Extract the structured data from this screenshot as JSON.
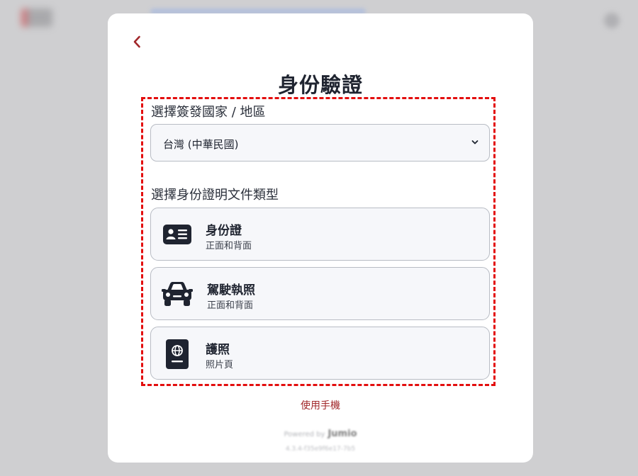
{
  "modal": {
    "title": "身份驗證",
    "country": {
      "label": "選擇簽發國家 / 地區",
      "selected": "台灣 (中華民國)"
    },
    "document_type": {
      "label": "選擇身份證明文件類型",
      "options": [
        {
          "title": "身份證",
          "subtitle": "正面和背面",
          "icon": "id-card-icon"
        },
        {
          "title": "駕駛執照",
          "subtitle": "正面和背面",
          "icon": "car-icon"
        },
        {
          "title": "護照",
          "subtitle": "照片頁",
          "icon": "passport-icon"
        }
      ]
    },
    "use_phone_link": "使用手機",
    "powered_by": {
      "text": "Powered by",
      "brand": "Jumio"
    },
    "version": "4.3.4-f35e9f6e17-7b5"
  },
  "colors": {
    "accent": "#a1272a",
    "highlight_border": "#e30e0e",
    "text": "#1f2430",
    "option_bg": "#f6f7fa"
  }
}
